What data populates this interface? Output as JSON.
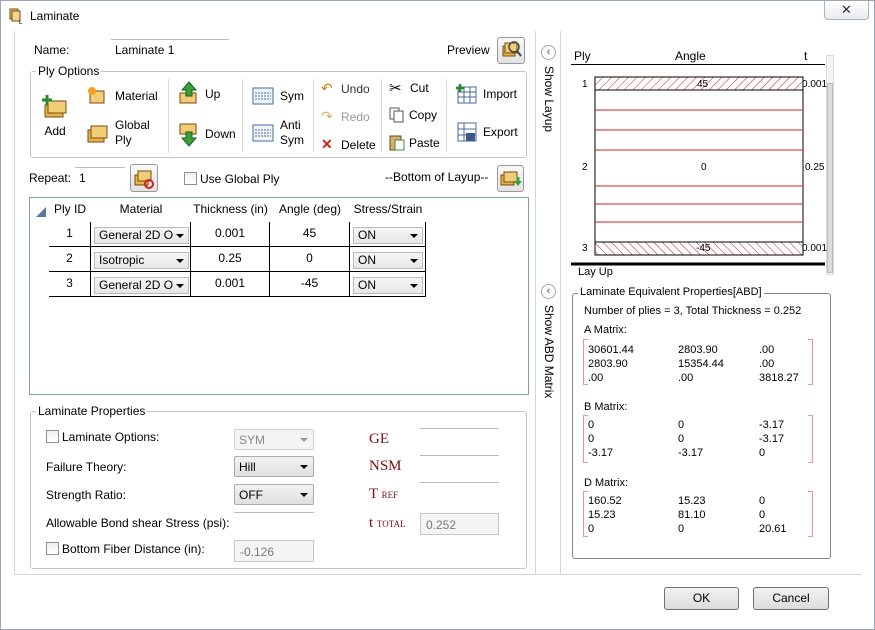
{
  "window": {
    "title": "Laminate",
    "close": "✕"
  },
  "name": {
    "label": "Name:",
    "value": "Laminate 1"
  },
  "preview": {
    "label": "Preview"
  },
  "ply_options": {
    "title": "Ply Options",
    "add": "Add",
    "material": "Material",
    "global_ply": "Global Ply",
    "up": "Up",
    "down": "Down",
    "sym": "Sym",
    "anti_sym": "Anti Sym",
    "undo": "Undo",
    "redo": "Redo",
    "delete": "Delete",
    "cut": "Cut",
    "copy": "Copy",
    "paste": "Paste",
    "import": "Import",
    "export": "Export"
  },
  "repeat": {
    "label": "Repeat:",
    "value": "1"
  },
  "use_global_ply": "Use Global Ply",
  "bottom_of_layup": "--Bottom of Layup--",
  "table": {
    "headers": [
      "Ply ID",
      "Material",
      "Thickness (in)",
      "Angle (deg)",
      "Stress/Strain"
    ],
    "rows": [
      {
        "id": "1",
        "material": "General 2D O",
        "thickness": "0.001",
        "angle": "45",
        "ss": "ON"
      },
      {
        "id": "2",
        "material": "Isotropic",
        "thickness": "0.25",
        "angle": "0",
        "ss": "ON"
      },
      {
        "id": "3",
        "material": "General 2D O",
        "thickness": "0.001",
        "angle": "-45",
        "ss": "ON"
      }
    ]
  },
  "laminate_properties": {
    "title": "Laminate Properties",
    "laminate_options": {
      "label": "Laminate Options:",
      "value": "SYM"
    },
    "failure_theory": {
      "label": "Failure Theory:",
      "value": "Hill"
    },
    "strength_ratio": {
      "label": "Strength Ratio:",
      "value": "OFF"
    },
    "bond_shear": {
      "label": "Allowable Bond shear Stress (psi):"
    },
    "bottom_fiber": {
      "label": "Bottom Fiber Distance (in):",
      "value": "-0.126"
    },
    "ge": "GE",
    "nsm": "NSM",
    "tref": "T",
    "tref_sub": "REF",
    "ttotal": "t",
    "ttotal_sub": "TOTAL",
    "ttotal_value": "0.252"
  },
  "side_tabs": {
    "show_layup": "Show Layup",
    "show_abd": "Show ABD Matrix"
  },
  "layup": {
    "headers": {
      "ply": "Ply",
      "angle": "Angle",
      "t": "t"
    },
    "plies": [
      {
        "num": "1",
        "angle": "45",
        "t": "0.001"
      },
      {
        "num": "2",
        "angle": "0",
        "t": "0.25"
      },
      {
        "num": "3",
        "angle": "-45",
        "t": "0.001"
      }
    ],
    "footer": "Lay Up"
  },
  "abd": {
    "title": "Laminate Equivalent Properties[ABD]",
    "summary": "Number of plies = 3, Total Thickness = 0.252",
    "a_label": "A Matrix:",
    "a": [
      [
        "30601.44",
        "2803.90",
        ".00"
      ],
      [
        "2803.90",
        "15354.44",
        ".00"
      ],
      [
        ".00",
        ".00",
        "3818.27"
      ]
    ],
    "b_label": "B Matrix:",
    "b": [
      [
        "0",
        "0",
        "-3.17"
      ],
      [
        "0",
        "0",
        "-3.17"
      ],
      [
        "-3.17",
        "-3.17",
        "0"
      ]
    ],
    "d_label": "D Matrix:",
    "d": [
      [
        "160.52",
        "15.23",
        "0"
      ],
      [
        "15.23",
        "81.10",
        "0"
      ],
      [
        "0",
        "0",
        "20.61"
      ]
    ]
  },
  "buttons": {
    "ok": "OK",
    "cancel": "Cancel"
  }
}
